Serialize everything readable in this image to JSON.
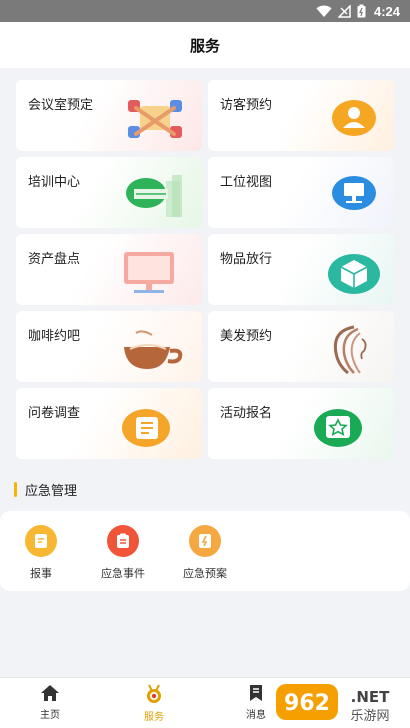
{
  "status_bar": {
    "time": "4:24"
  },
  "header": {
    "title": "服务"
  },
  "services": [
    {
      "label": "会议室预定",
      "icon": "meeting-room-icon"
    },
    {
      "label": "访客预约",
      "icon": "visitor-icon"
    },
    {
      "label": "培训中心",
      "icon": "training-icon"
    },
    {
      "label": "工位视图",
      "icon": "workstation-icon"
    },
    {
      "label": "资产盘点",
      "icon": "asset-icon"
    },
    {
      "label": "物品放行",
      "icon": "item-release-icon"
    },
    {
      "label": "咖啡约吧",
      "icon": "coffee-icon"
    },
    {
      "label": "美发预约",
      "icon": "hairdressing-icon"
    },
    {
      "label": "问卷调查",
      "icon": "survey-icon"
    },
    {
      "label": "活动报名",
      "icon": "activity-icon"
    }
  ],
  "emergency": {
    "title": "应急管理",
    "items": [
      {
        "label": "报事",
        "icon": "report-icon",
        "color": "#f7b733"
      },
      {
        "label": "应急事件",
        "icon": "incident-icon",
        "color": "#f0553a"
      },
      {
        "label": "应急预案",
        "icon": "plan-icon",
        "color": "#f5a841"
      }
    ]
  },
  "tabs": [
    {
      "label": "主页",
      "icon": "home-icon",
      "active": false
    },
    {
      "label": "服务",
      "icon": "service-medal-icon",
      "active": true
    },
    {
      "label": "消息",
      "icon": "message-icon",
      "active": false
    }
  ],
  "watermark": {
    "brand": "962",
    "suffix": ".NET",
    "sub": "乐游网"
  },
  "colors": {
    "accent": "#e0a000",
    "section_bar": "#f2b705"
  }
}
